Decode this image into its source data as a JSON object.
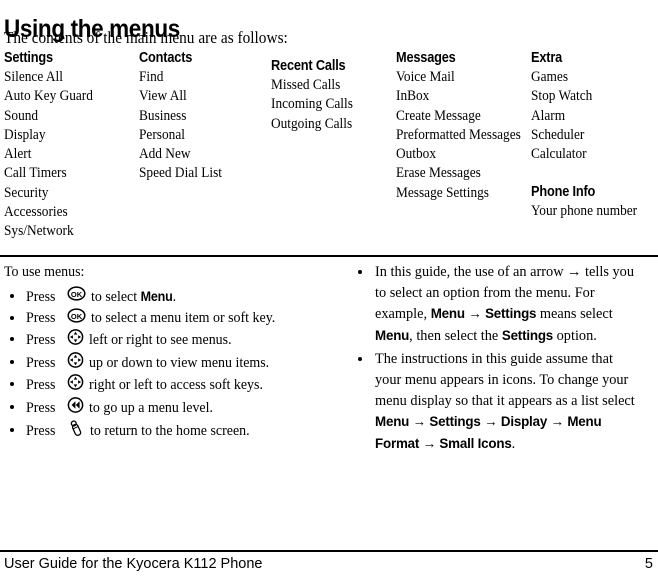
{
  "page": {
    "title": "Using the menus",
    "intro": "The contents of the main menu are as follows:"
  },
  "menu_columns": [
    {
      "header": "Settings",
      "items": [
        "Silence All",
        "Auto Key Guard",
        "Sound",
        "Display",
        "Alert",
        "Call Timers",
        "Security",
        "Accessories",
        "Sys/Network"
      ]
    },
    {
      "header": "Contacts",
      "items": [
        "Find",
        "View All",
        "Business",
        "Personal",
        "Add New",
        "Speed Dial List"
      ]
    },
    {
      "header": "Recent Calls",
      "items": [
        "Missed Calls",
        "Incoming Calls",
        "Outgoing Calls"
      ]
    },
    {
      "header": "Messages",
      "items": [
        "Voice Mail",
        "InBox",
        "Create Message",
        "Preformatted Messages",
        "Outbox",
        "Erase Messages",
        "Message Settings"
      ]
    },
    {
      "header": "Extra",
      "items": [
        "Games",
        "Stop Watch",
        "Alarm",
        "Scheduler",
        "Calculator"
      ],
      "sub_header": "Phone Info",
      "sub_items": [
        "Your phone number"
      ]
    }
  ],
  "instructions": {
    "lead": "To use menus:",
    "steps": [
      {
        "verb": "Press",
        "icon": "ok-key-icon",
        "tail_pre": "to select ",
        "tail_bold": "Menu",
        "tail_post": "."
      },
      {
        "verb": "Press",
        "icon": "ok-key-icon",
        "tail_pre": "to select a menu item or soft key.",
        "tail_bold": "",
        "tail_post": ""
      },
      {
        "verb": "Press",
        "icon": "navigation-pad-icon",
        "tail_pre": "left or right to see menus.",
        "tail_bold": "",
        "tail_post": ""
      },
      {
        "verb": "Press",
        "icon": "navigation-pad-icon",
        "tail_pre": "up or down to view menu items.",
        "tail_bold": "",
        "tail_post": ""
      },
      {
        "verb": "Press",
        "icon": "navigation-pad-icon",
        "tail_pre": "right or left to access soft keys.",
        "tail_bold": "",
        "tail_post": ""
      },
      {
        "verb": "Press",
        "icon": "back-key-icon",
        "tail_pre": "to go up a menu level.",
        "tail_bold": "",
        "tail_post": ""
      },
      {
        "verb": "Press",
        "icon": "end-call-key-icon",
        "tail_pre": "to return to the home screen.",
        "tail_bold": "",
        "tail_post": ""
      }
    ],
    "notes": [
      {
        "segments": [
          {
            "text": "In this guide, the use of an arrow ",
            "bold": false
          },
          {
            "text": "→",
            "bold": false
          },
          {
            "text": " tells you to select an option from the menu. For example, ",
            "bold": false
          },
          {
            "text": "Menu",
            "bold": true
          },
          {
            "text": " → ",
            "bold": true
          },
          {
            "text": "Settings",
            "bold": true
          },
          {
            "text": " means select ",
            "bold": false
          },
          {
            "text": "Menu",
            "bold": true
          },
          {
            "text": ", then select the ",
            "bold": false
          },
          {
            "text": "Settings",
            "bold": true
          },
          {
            "text": " option.",
            "bold": false
          }
        ]
      },
      {
        "segments": [
          {
            "text": "The instructions in this guide assume that your menu appears in icons. To change your menu display so that it appears as a list select ",
            "bold": false
          },
          {
            "text": "Menu",
            "bold": true
          },
          {
            "text": " → ",
            "bold": true
          },
          {
            "text": "Settings",
            "bold": true
          },
          {
            "text": " → ",
            "bold": true
          },
          {
            "text": "Display",
            "bold": true
          },
          {
            "text": " → ",
            "bold": true
          },
          {
            "text": "Menu Format",
            "bold": true
          },
          {
            "text": " → ",
            "bold": true
          },
          {
            "text": "Small Icons",
            "bold": true
          },
          {
            "text": ".",
            "bold": false
          }
        ]
      }
    ]
  },
  "footer": {
    "title": "User Guide for the Kyocera K112 Phone",
    "page_number": "5"
  },
  "colors": {
    "ink": "#000000",
    "paper": "#ffffff"
  }
}
